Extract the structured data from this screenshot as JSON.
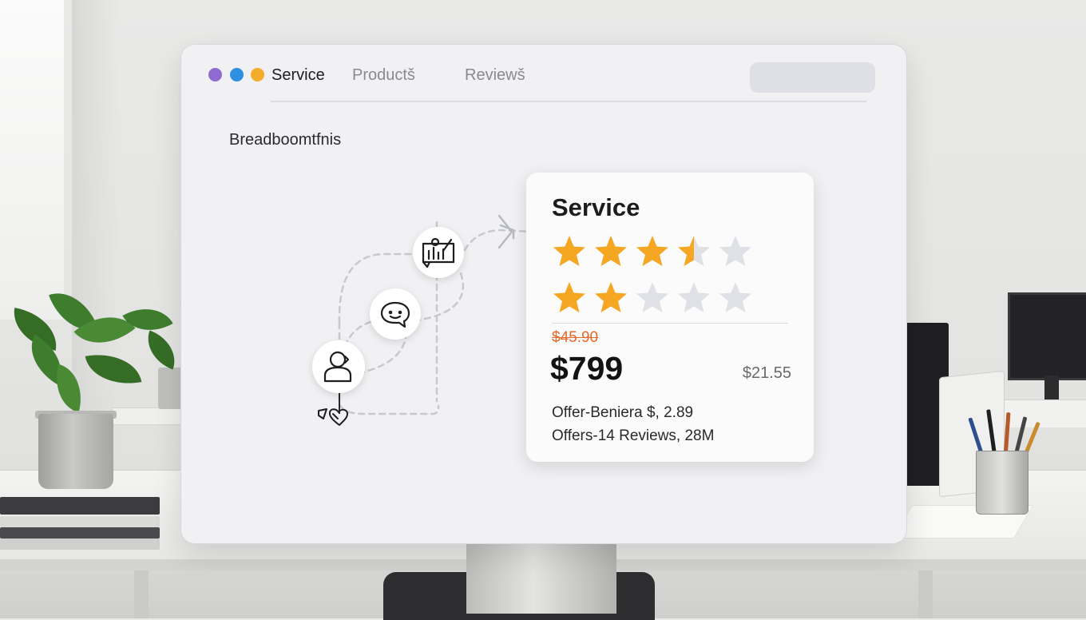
{
  "window": {
    "control_colors": [
      "#8e6bd0",
      "#2f8fe0",
      "#f4ad2a"
    ]
  },
  "nav": {
    "tabs": [
      {
        "label": "Service",
        "active": true
      },
      {
        "label": "Productš",
        "active": false
      },
      {
        "label": "Reviewš",
        "active": false
      }
    ]
  },
  "breadcrumb": "Breadboomtfnis",
  "flow": {
    "icons": [
      "presentation-icon",
      "chat-bubble-icon",
      "user-icon",
      "heart-icon",
      "arrow-right-icon"
    ]
  },
  "card": {
    "title": "Service",
    "rating_rows": [
      {
        "rating": 3.5,
        "max": 5
      },
      {
        "rating": 2,
        "max": 5
      }
    ],
    "old_price": "$45.90",
    "price": "$799",
    "side_price": "$21.55",
    "offers": [
      "Offer-Beniera $, 2.89",
      "Offers-14 Reviews, 28M"
    ],
    "colors": {
      "star": "#f5a623",
      "star_empty": "#dfe1e6",
      "old_price": "#e46a2a"
    }
  }
}
